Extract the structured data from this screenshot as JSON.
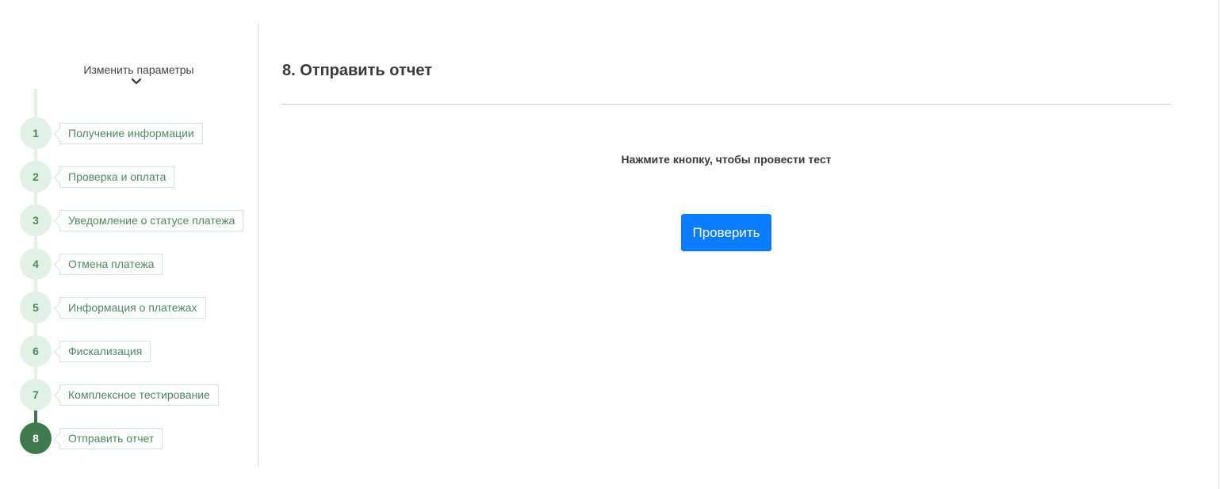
{
  "sidebar": {
    "change_params_label": "Изменить параметры",
    "toggle_icon": "chevron-down-icon",
    "active_step": "8",
    "steps": [
      {
        "number": "1",
        "label": "Получение информации"
      },
      {
        "number": "2",
        "label": "Проверка и оплата"
      },
      {
        "number": "3",
        "label": "Уведомление о статусе платежа"
      },
      {
        "number": "4",
        "label": "Отмена платежа"
      },
      {
        "number": "5",
        "label": "Информация о платежах"
      },
      {
        "number": "6",
        "label": "Фискализация"
      },
      {
        "number": "7",
        "label": "Комплексное тестирование"
      },
      {
        "number": "8",
        "label": "Отправить отчет"
      }
    ]
  },
  "main": {
    "title": "8. Отправить отчет",
    "instruction": "Нажмите кнопку, чтобы провести тест",
    "check_button_label": "Проверить"
  },
  "colors": {
    "accent_blue": "#0a7cff",
    "step_active": "#3f7a4d",
    "step_inactive_bg": "#e1f1e3",
    "step_text": "#4f8a5d"
  }
}
